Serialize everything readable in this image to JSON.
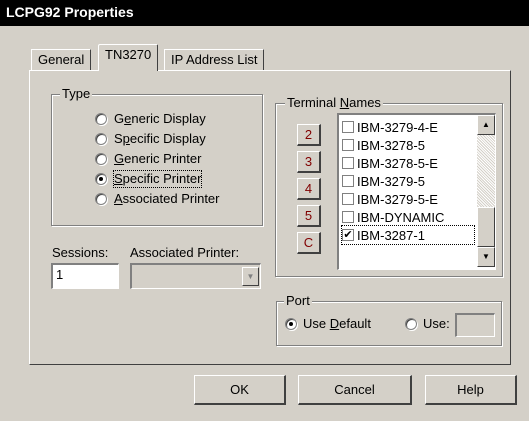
{
  "window": {
    "title": "LCPG92 Properties"
  },
  "tabs": [
    {
      "label": "General"
    },
    {
      "label": "TN3270"
    },
    {
      "label": "IP Address List"
    }
  ],
  "type_group": {
    "legend": "Type",
    "options": [
      {
        "pre": "G",
        "u": "e",
        "post": "neric Display",
        "selected": false
      },
      {
        "pre": "S",
        "u": "p",
        "post": "ecific Display",
        "selected": false
      },
      {
        "pre": "",
        "u": "G",
        "post": "eneric Printer",
        "selected": false
      },
      {
        "pre": "",
        "u": "S",
        "post": "pecific Printer",
        "selected": true
      },
      {
        "pre": "",
        "u": "A",
        "post": "ssociated Printer",
        "selected": false
      }
    ]
  },
  "sessions": {
    "label": "Sessions:",
    "value": "1"
  },
  "associated_printer": {
    "label": "Associated Printer:",
    "value": ""
  },
  "terminal_names": {
    "legend_pre": "Terminal ",
    "legend_u": "N",
    "legend_post": "ames",
    "side_buttons": [
      "2",
      "3",
      "4",
      "5",
      "C"
    ],
    "items": [
      {
        "label": "IBM-3279-4-E",
        "checked": false
      },
      {
        "label": "IBM-3278-5",
        "checked": false
      },
      {
        "label": "IBM-3278-5-E",
        "checked": false
      },
      {
        "label": "IBM-3279-5",
        "checked": false
      },
      {
        "label": "IBM-3279-5-E",
        "checked": false
      },
      {
        "label": "IBM-DYNAMIC",
        "checked": false
      },
      {
        "label": "IBM-3287-1",
        "checked": true
      }
    ],
    "scroll_up_icon": "up-arrow",
    "scroll_down_icon": "down-arrow"
  },
  "port": {
    "legend": "Port",
    "use_default": {
      "pre": "Use ",
      "u": "D",
      "post": "efault",
      "selected": true
    },
    "use": {
      "label": "Use:",
      "selected": false,
      "value": ""
    }
  },
  "buttons": {
    "ok": "OK",
    "cancel": "Cancel",
    "help": "Help"
  }
}
